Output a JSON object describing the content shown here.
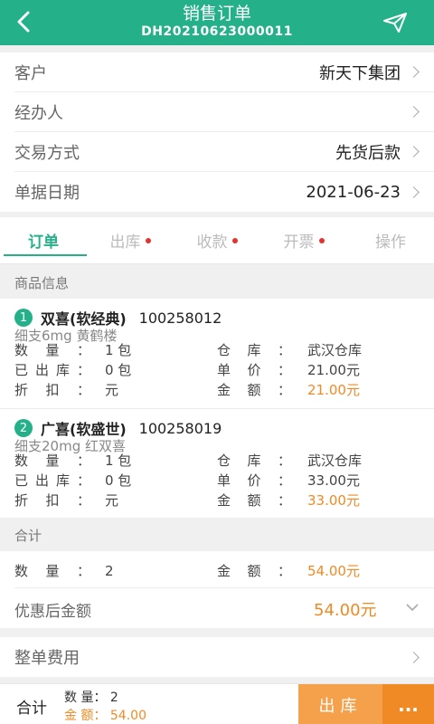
{
  "header": {
    "title": "销售订单",
    "order_no": "DH20210623000011",
    "back_icon": "chevron-left-icon",
    "send_icon": "paper-plane-icon"
  },
  "info": {
    "customer": {
      "label": "客户",
      "value": "新天下集团"
    },
    "handler": {
      "label": "经办人",
      "value": ""
    },
    "trade_method": {
      "label": "交易方式",
      "value": "先货后款"
    },
    "doc_date": {
      "label": "单据日期",
      "value": "2021-06-23"
    }
  },
  "tabs": [
    {
      "label": "订单",
      "active": true,
      "dot": false
    },
    {
      "label": "出库",
      "active": false,
      "dot": true
    },
    {
      "label": "收款",
      "active": false,
      "dot": true
    },
    {
      "label": "开票",
      "active": false,
      "dot": true
    },
    {
      "label": "操作",
      "active": false,
      "dot": false
    }
  ],
  "product_section_title": "商品信息",
  "labels": {
    "qty": "数量：",
    "shipped": "已出库：",
    "discount": "折扣：",
    "warehouse": "仓库：",
    "unit_price": "单价：",
    "amount": "金额："
  },
  "products": [
    {
      "index": "1",
      "name": "双喜(软经典)",
      "code": "100258012",
      "spec": "细支6mg 黄鹤楼",
      "qty": "1 包",
      "shipped": "0 包",
      "discount": "元",
      "warehouse": "武汉仓库",
      "unit_price": "21.00元",
      "amount": "21.00元"
    },
    {
      "index": "2",
      "name": "广喜(软盛世)",
      "code": "100258019",
      "spec": "细支20mg 红双喜",
      "qty": "1 包",
      "shipped": "0 包",
      "discount": "元",
      "warehouse": "武汉仓库",
      "unit_price": "33.00元",
      "amount": "33.00元"
    }
  ],
  "total_section": {
    "title": "合计",
    "qty": "2",
    "amount": "54.00元",
    "discounted_label": "优惠后金额",
    "discounted_value": "54.00元"
  },
  "fee": {
    "label": "整单费用"
  },
  "bottom": {
    "sum_label": "合计",
    "qty_text": "数 量： 2",
    "amount_text": "金 额： 54.00",
    "ship_button": "出库",
    "more_button": "..."
  },
  "colors": {
    "primary": "#24b089",
    "accent": "#f08a24",
    "dot": "#e5322d"
  }
}
